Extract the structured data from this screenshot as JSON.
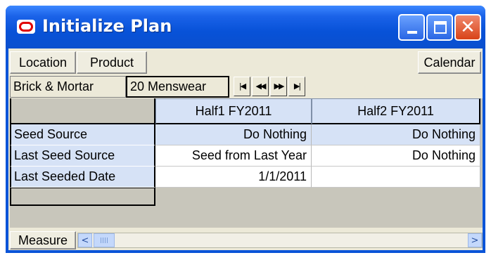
{
  "window": {
    "title": "Initialize Plan",
    "icons": {
      "app": "oracle-logo-icon",
      "minimize": "minimize-icon",
      "maximize": "maximize-icon",
      "close": "close-icon"
    },
    "close_glyph": "✕"
  },
  "toolbar": {
    "location_label": "Location",
    "product_label": "Product",
    "calendar_label": "Calendar"
  },
  "page_selector": {
    "location_value": "Brick & Mortar",
    "product_value": "20 Menswear",
    "nav": [
      "|◀",
      "◀◀",
      "▶▶",
      "▶|"
    ],
    "nav_icons": [
      "first-page-icon",
      "previous-page-icon",
      "next-page-icon",
      "last-page-icon"
    ]
  },
  "grid": {
    "columns": [
      "Half1 FY2011",
      "Half2 FY2011"
    ],
    "rows": [
      {
        "label": "Seed Source",
        "values": [
          "Do Nothing",
          "Do Nothing"
        ]
      },
      {
        "label": "Last Seed Source",
        "values": [
          "Seed from Last Year",
          "Do Nothing"
        ]
      },
      {
        "label": "Last Seeded Date",
        "values": [
          "1/1/2011",
          ""
        ]
      }
    ]
  },
  "footer": {
    "measure_label": "Measure",
    "scroll_left": "<",
    "scroll_right": ">"
  },
  "colors": {
    "titlebar": "#0a54d8",
    "header_fill": "#d6e2f6",
    "client_bg": "#ece9d8",
    "close_button": "#d84318"
  }
}
